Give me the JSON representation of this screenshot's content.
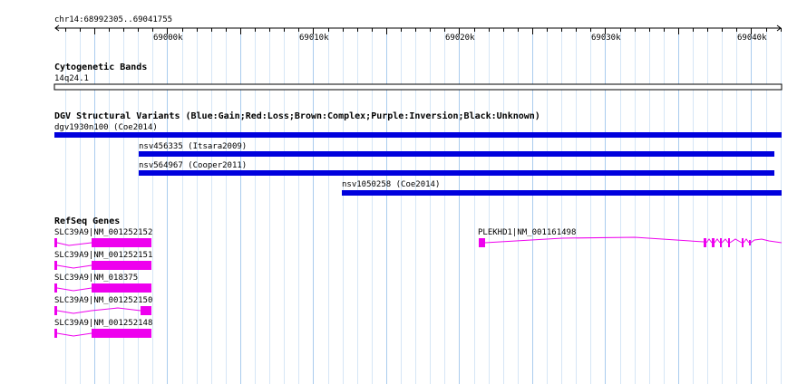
{
  "ruler": {
    "position_label": "chr14:68992305..69041755",
    "ticks": [
      "69000k",
      "69010k",
      "69020k",
      "69030k",
      "69040k"
    ]
  },
  "tracks": {
    "cytoband": {
      "title": "Cytogenetic Bands",
      "band_label": "14q24.1"
    },
    "dgv": {
      "title": "DGV Structural Variants (Blue:Gain;Red:Loss;Brown:Complex;Purple:Inversion;Black:Unknown)",
      "features": [
        {
          "label": "dgv1930n100 (Coe2014)"
        },
        {
          "label": "nsv456335 (Itsara2009)"
        },
        {
          "label": "nsv564967 (Cooper2011)"
        },
        {
          "label": "nsv1050258 (Coe2014)"
        }
      ]
    },
    "refseq": {
      "title": "RefSeq Genes",
      "genes": [
        {
          "label": "SLC39A9|NM_001252152"
        },
        {
          "label": "SLC39A9|NM_001252151"
        },
        {
          "label": "SLC39A9|NM_018375"
        },
        {
          "label": "SLC39A9|NM_001252150"
        },
        {
          "label": "SLC39A9|NM_001252148"
        },
        {
          "label": "PLEKHD1|NM_001161498"
        }
      ]
    }
  },
  "colors": {
    "gain": "#0000dd",
    "gene": "#ee00ee",
    "grid_major": "#aaccee",
    "grid_minor": "#d6e6f6"
  }
}
